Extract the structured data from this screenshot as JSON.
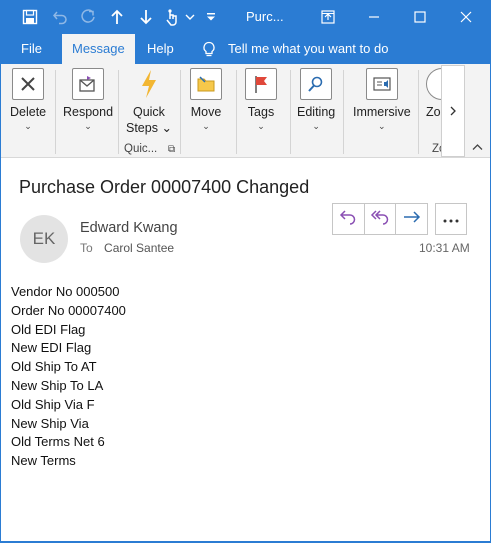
{
  "window": {
    "title": "Purc...",
    "buttons": [
      "restore",
      "minimize",
      "maximize",
      "close"
    ]
  },
  "quick_access": {
    "icons": [
      "save-icon",
      "undo-icon",
      "redo-icon",
      "up-arrow-icon",
      "down-arrow-icon",
      "touch-mode-icon",
      "customize-icon"
    ]
  },
  "menu": {
    "file": "File",
    "message": "Message",
    "help": "Help",
    "tell_me": "Tell me what you want to do"
  },
  "ribbon": {
    "delete": "Delete",
    "respond": "Respond",
    "quick_steps_line1": "Quick",
    "quick_steps_line2": "Steps",
    "quick_steps_group": "Quic...",
    "move": "Move",
    "tags": "Tags",
    "editing": "Editing",
    "immersive": "Immersive",
    "zoom_partial": "Zo",
    "zoom_group_partial": "Zo"
  },
  "message": {
    "subject": "Purchase Order 00007400 Changed",
    "avatar_initials": "EK",
    "sender": "Edward Kwang",
    "to_label": "To",
    "recipient": "Carol Santee",
    "time": "10:31 AM",
    "body": [
      "Vendor No 000500",
      "Order No 00007400",
      "Old EDI Flag",
      "New EDI Flag",
      "Old Ship To AT",
      "New Ship To LA",
      "Old Ship Via F",
      "New Ship Via",
      "Old Terms Net 6",
      "New Terms"
    ]
  },
  "colors": {
    "accent": "#2b7cd3",
    "ribbon_bg": "#f3f3f3",
    "reply_purple": "#8a4fb3",
    "forward_blue": "#2b6cb0"
  }
}
